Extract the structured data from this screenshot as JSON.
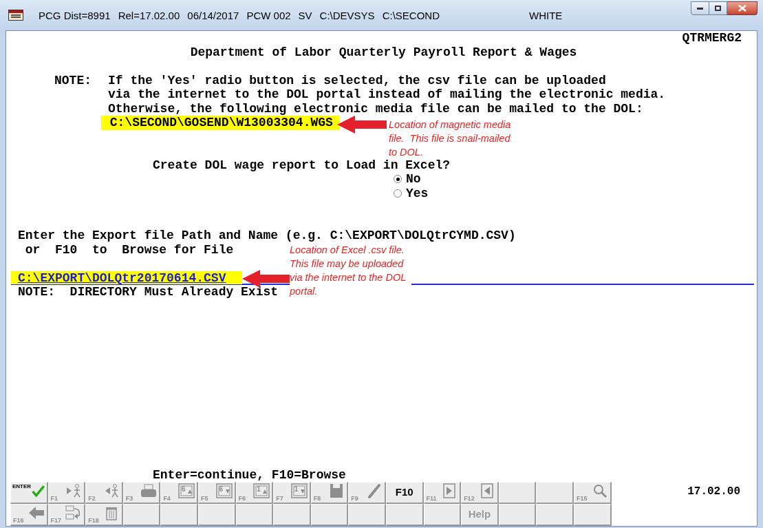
{
  "window": {
    "title_segments": [
      "PCG Dist=8991",
      "Rel=17.02.00",
      "06/14/2017",
      "PCW 002",
      "SV",
      "C:\\DEVSYS",
      "C:\\SECOND"
    ],
    "user": "WHITE"
  },
  "screen_id": "QTRMERG2",
  "heading": "Department of Labor Quarterly Payroll Report & Wages",
  "note": {
    "label": "NOTE:",
    "lines": [
      "If the 'Yes' radio button is selected, the csv file can be uploaded",
      "via the internet to the DOL portal instead of mailing the electronic media.",
      "Otherwise, the following electronic media file can be mailed to the DOL:"
    ]
  },
  "media_file": "C:\\SECOND\\GOSEND\\W13003304.WGS",
  "question": "Create DOL wage report to Load in Excel?",
  "options": [
    {
      "label": "No",
      "selected": true
    },
    {
      "label": "Yes",
      "selected": false
    }
  ],
  "export_prompt": [
    "Enter the Export file Path and Name (e.g. C:\\EXPORT\\DOLQtrCYMD.CSV)",
    " or  F10  to  Browse for File"
  ],
  "export_path": "C:\\EXPORT\\DOLQtr20170614.CSV",
  "directory_note": "NOTE:  DIRECTORY Must Already Exist",
  "annotations": [
    {
      "lines": [
        "Location of magnetic media",
        "file.  This file is snail-mailed",
        "to DOL."
      ]
    },
    {
      "lines": [
        "Location of Excel .csv file.",
        "This file may be uploaded",
        "via the internet to the DOL",
        "portal."
      ]
    }
  ],
  "footer_hint": "Enter=continue, F10=Browse",
  "version": "17.02.00",
  "function_keys": [
    [
      {
        "label": "ENTER",
        "kind": "check",
        "disabled": false
      },
      {
        "label": "F1",
        "kind": "walk-right",
        "disabled": true
      },
      {
        "label": "F2",
        "kind": "walk-left",
        "disabled": true
      },
      {
        "label": "F3",
        "kind": "printer",
        "disabled": true
      },
      {
        "label": "F4",
        "kind": "window-up",
        "digit": "6",
        "disabled": true
      },
      {
        "label": "F5",
        "kind": "window-down",
        "digit": "6",
        "disabled": true
      },
      {
        "label": "F6",
        "kind": "window-up",
        "digit": "1",
        "disabled": true
      },
      {
        "label": "F7",
        "kind": "window-down",
        "digit": "1",
        "disabled": true
      },
      {
        "label": "F8",
        "kind": "save",
        "disabled": true
      },
      {
        "label": "F9",
        "kind": "pencil",
        "disabled": true
      },
      {
        "label": "F10",
        "kind": "text",
        "disabled": false
      },
      {
        "label": "F11",
        "kind": "play-right",
        "disabled": true
      },
      {
        "label": "F12",
        "kind": "play-left",
        "disabled": true
      },
      {
        "kind": "blank"
      },
      {
        "kind": "blank"
      },
      {
        "label": "F15",
        "kind": "magnifier",
        "disabled": true
      }
    ],
    [
      {
        "label": "F16",
        "kind": "arrow-left",
        "disabled": true
      },
      {
        "label": "F17",
        "kind": "transfer",
        "disabled": true
      },
      {
        "label": "F18",
        "kind": "trash",
        "disabled": true
      },
      {
        "kind": "blank"
      },
      {
        "kind": "blank"
      },
      {
        "kind": "blank"
      },
      {
        "kind": "blank"
      },
      {
        "kind": "blank"
      },
      {
        "kind": "blank"
      },
      {
        "kind": "blank"
      },
      {
        "kind": "blank"
      },
      {
        "kind": "blank"
      },
      {
        "label": "Help",
        "kind": "text",
        "disabled": true
      },
      {
        "kind": "blank"
      },
      {
        "kind": "blank"
      },
      {
        "kind": "blank"
      }
    ]
  ]
}
